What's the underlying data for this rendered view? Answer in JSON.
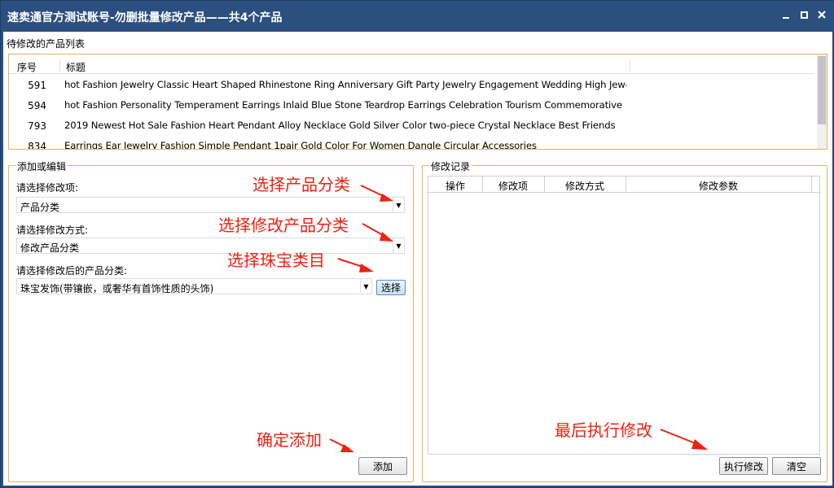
{
  "window": {
    "title": "速卖通官方测试账号-勿删批量修改产品——共4个产品",
    "controls": [
      "minimize-icon",
      "maximize-icon",
      "close-icon"
    ]
  },
  "product_list": {
    "section_label": "待修改的产品列表",
    "columns": [
      "序号",
      "标题"
    ],
    "rows": [
      {
        "num": "591",
        "title": "hot Fashion Jewelry Classic Heart Shaped Rhinestone Ring Anniversary Gift Party Jewelry Engagement Wedding High Jewelry"
      },
      {
        "num": "594",
        "title": "hot Fashion Personality Temperament Earrings Inlaid Blue Stone Teardrop Earrings Celebration Tourism Commemorative"
      },
      {
        "num": "793",
        "title": "2019 Newest Hot Sale Fashion Heart Pendant Alloy Necklace Gold Silver Color two-piece Crystal Necklace Best Friends"
      },
      {
        "num": "834",
        "title": "Earrings Ear Jewelry Fashion Simple Pendant 1pair Gold Color For Women Dangle Circular Accessories"
      }
    ]
  },
  "add_edit": {
    "group_title": "添加或编辑",
    "item_label": "请选择修改项:",
    "item_value": "产品分类",
    "method_label": "请选择修改方式:",
    "method_value": "修改产品分类",
    "category_label": "请选择修改后的产品分类:",
    "category_value": "珠宝发饰(带镶嵌，或奢华有首饰性质的头饰)",
    "select_button": "选择",
    "add_button": "添加"
  },
  "records": {
    "group_title": "修改记录",
    "columns": [
      "操作",
      "修改项",
      "修改方式",
      "修改参数"
    ],
    "execute_button": "执行修改",
    "clear_button": "清空"
  },
  "annotations": {
    "select_category": "选择产品分类",
    "select_modify_category": "选择修改产品分类",
    "select_jewelry": "选择珠宝类目",
    "confirm_add": "确定添加",
    "finally_execute": "最后执行修改",
    "color": "#ee2211"
  }
}
